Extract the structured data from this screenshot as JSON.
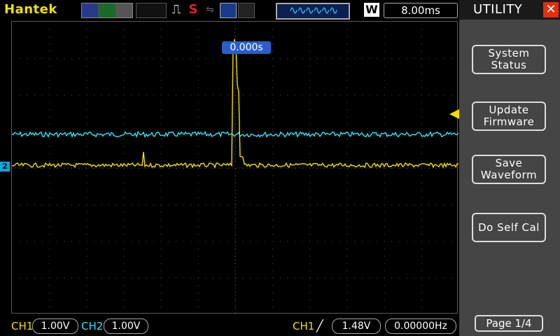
{
  "brand": "Hantek",
  "topbar": {
    "timebase": "8.00ms",
    "w_label": "W",
    "stop_label": "S",
    "trig_icon": "⎍",
    "usb_icon": "⇋",
    "memory_wave": "∿∿∿∿∿∿"
  },
  "scope": {
    "trigger_position": "0.000s",
    "ch2_marker": "2",
    "ch1_color": "#f0e000",
    "ch2_color": "#2ee6ff",
    "grid_color": "#5a5a5a"
  },
  "bottom": {
    "ch1_label": "CH1",
    "ch1_scale": "1.00V",
    "ch2_label": "CH2",
    "ch2_scale": "1.00V",
    "trigger_source": "CH1",
    "edge_icon": "rising-edge-icon",
    "edge_glyph": "╱",
    "trigger_level": "1.48V",
    "frequency": "0.00000Hz"
  },
  "menu": {
    "title": "UTILITY",
    "close_glyph": "✕",
    "buttons": [
      {
        "line1": "System",
        "line2": "Status"
      },
      {
        "line1": "Update",
        "line2": "Firmware"
      },
      {
        "line1": "Save",
        "line2": "Waveform"
      },
      {
        "line1": "Do Self Cal",
        "line2": ""
      }
    ],
    "page": "Page 1/4"
  }
}
